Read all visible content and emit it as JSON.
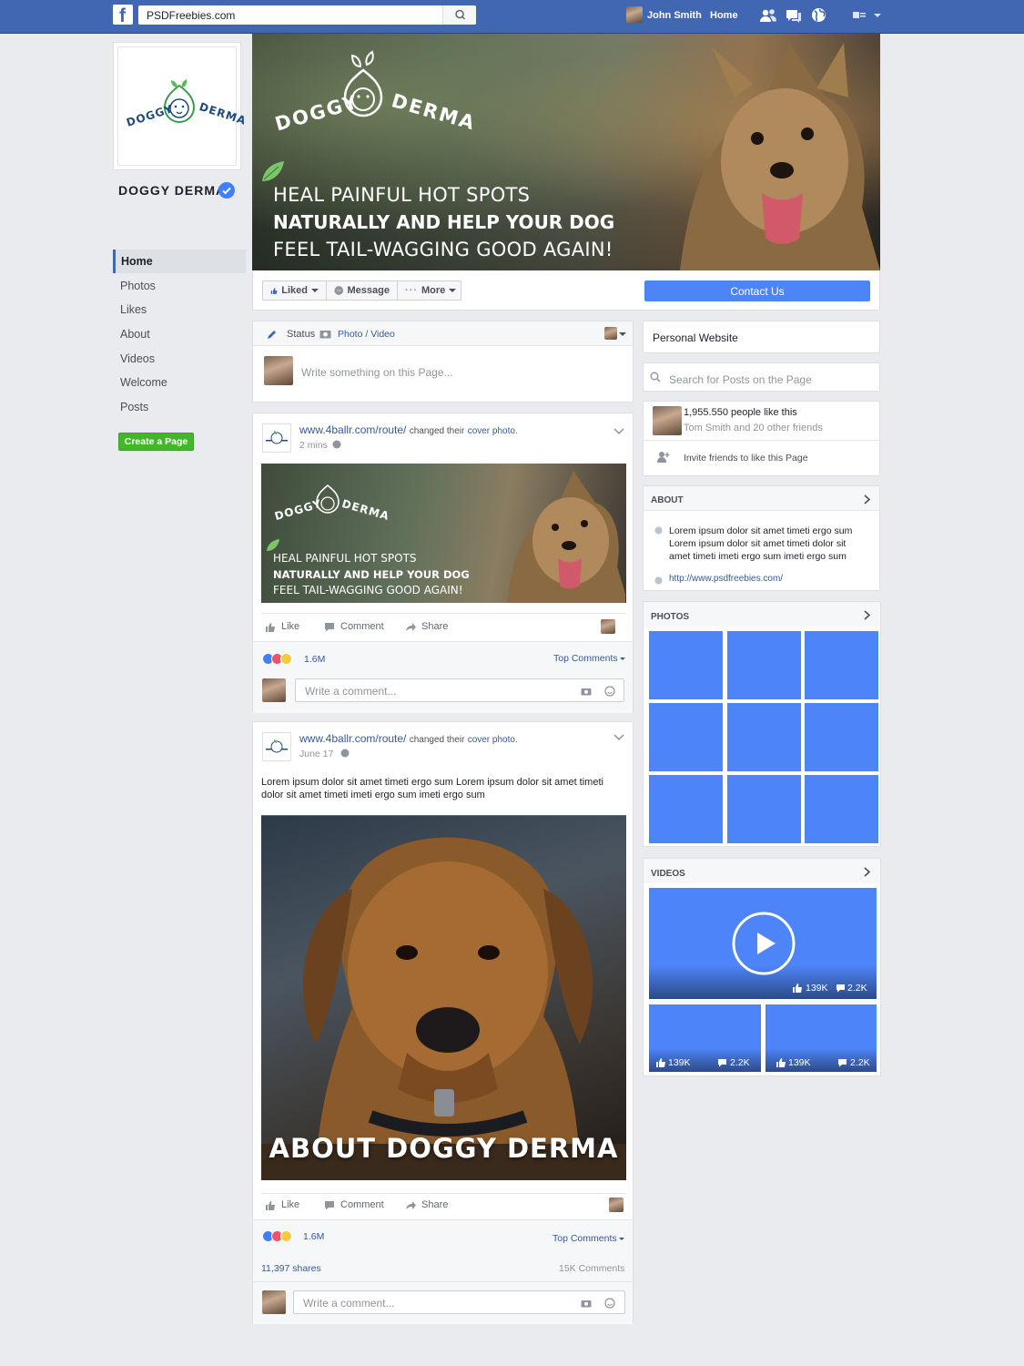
{
  "topbar": {
    "logo": "f",
    "search_value": "PSDFreebies.com",
    "user_name": "John Smith",
    "home_label": "Home"
  },
  "profile": {
    "logo_word1": "DOGGY",
    "logo_word2": "DERMA",
    "page_name": "DOGGY DERMA"
  },
  "nav": {
    "items": [
      "Home",
      "Photos",
      "Likes",
      "About",
      "Videos",
      "Welcome",
      "Posts"
    ],
    "create_page": "Create a Page"
  },
  "cover": {
    "logo_word1": "DOGGY",
    "logo_word2": "DERMA",
    "line1": "HEAL PAINFUL HOT SPOTS",
    "line2": "NATURALLY AND HELP YOUR DOG",
    "line3": "FEEL TAIL-WAGGING GOOD AGAIN!"
  },
  "actions": {
    "liked": "Liked",
    "message": "Message",
    "more": "More",
    "contact": "Contact Us"
  },
  "composer": {
    "status": "Status",
    "photo_video": "Photo / Video",
    "placeholder": "Write something on this Page..."
  },
  "post1": {
    "url": "www.4ballr.com/route/",
    "changed": "changed their",
    "cover_photo": "cover photo.",
    "time": "2 mins",
    "img_logo1": "DOGGY",
    "img_logo2": "DERMA",
    "img_line1": "HEAL PAINFUL HOT SPOTS",
    "img_line2": "NATURALLY AND HELP YOUR DOG",
    "img_line3": "FEEL TAIL-WAGGING GOOD AGAIN!",
    "like": "Like",
    "comment": "Comment",
    "share": "Share",
    "reactions": "1.6M",
    "top_comments": "Top Comments",
    "comment_placeholder": "Write a comment..."
  },
  "post2": {
    "url": "www.4ballr.com/route/",
    "changed": "changed their",
    "cover_photo": "cover photo.",
    "time": "June 17",
    "text": "Lorem ipsum dolor sit amet timeti ergo sum Lorem ipsum dolor sit amet timeti dolor sit amet timeti imeti ergo sum imeti ergo sum",
    "img_caption": "ABOUT DOGGY DERMA",
    "like": "Like",
    "comment": "Comment",
    "share": "Share",
    "reactions": "1.6M",
    "top_comments": "Top Comments",
    "shares": "11,397 shares",
    "comments_count": "15K Comments",
    "comment_placeholder": "Write a comment..."
  },
  "sidebar": {
    "website": "Personal Website",
    "search_placeholder": "Search for Posts on the Page",
    "likes_count": "1,955.550 people like this",
    "likes_friends": "Tom Smith and 20 other friends",
    "invite": "Invite friends to like this Page",
    "about_title": "ABOUT",
    "about_text": "Lorem ipsum dolor sit amet timeti ergo sum Lorem ipsum dolor sit amet timeti dolor sit amet timeti imeti ergo sum imeti ergo sum",
    "about_link": "http://www.psdfreebies.com/",
    "photos_title": "PHOTOS",
    "videos_title": "VIDEOS",
    "video_main_likes": "139K",
    "video_main_comments": "2.2K",
    "video2_likes": "139K",
    "video2_comments": "2.2K",
    "video3_likes": "139K",
    "video3_comments": "2.2K"
  },
  "colors": {
    "brand_blue": "#4267b2",
    "tile_blue": "#4d84f7",
    "create_green": "#42b72a",
    "verified_blue": "#4080ff"
  }
}
